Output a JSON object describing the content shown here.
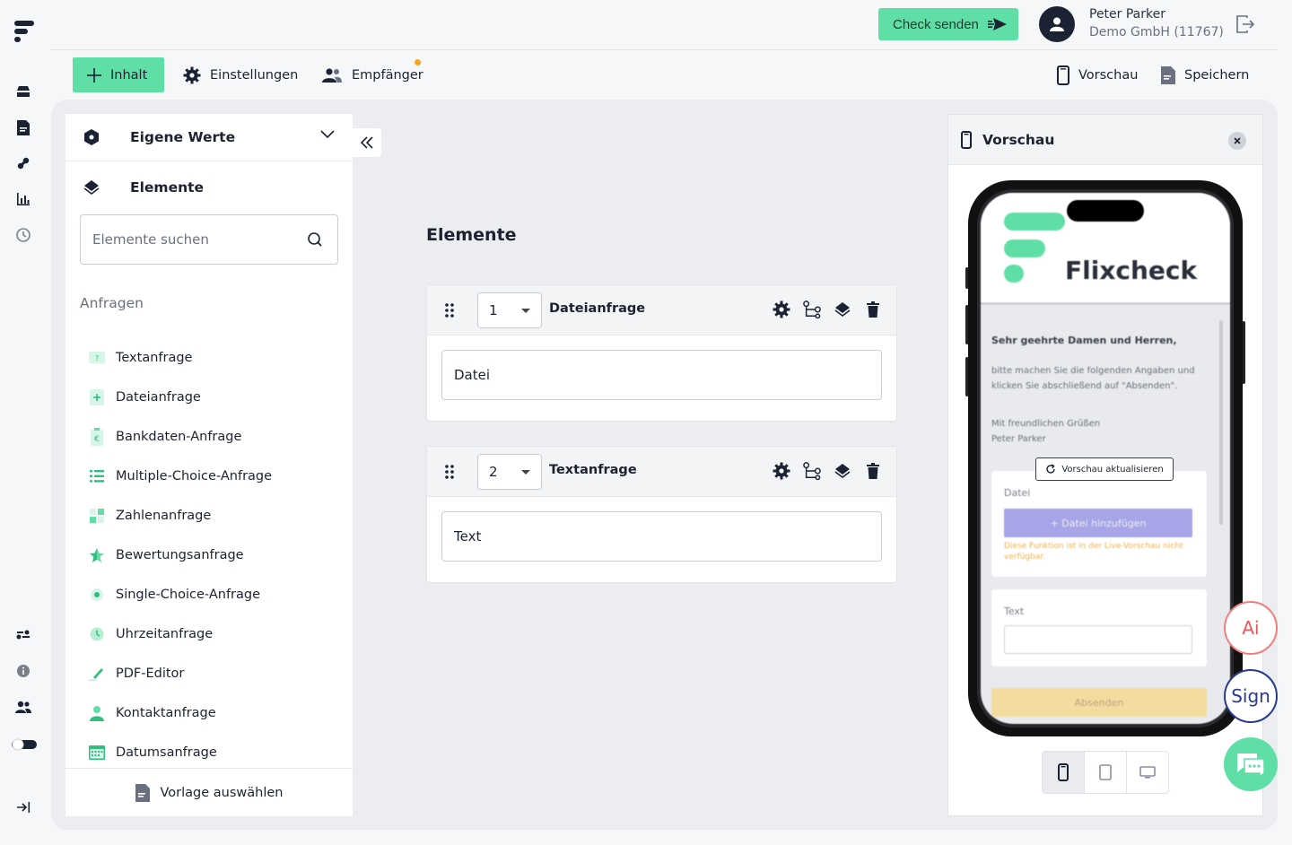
{
  "header": {
    "check_send_label": "Check senden",
    "user_name": "Peter Parker",
    "user_org": "Demo GmbH (11767)"
  },
  "toolbar": {
    "inhalt_label": "Inhalt",
    "einstellungen_label": "Einstellungen",
    "empfaenger_label": "Empfänger",
    "vorschau_label": "Vorschau",
    "speichern_label": "Speichern"
  },
  "sidebar": {
    "section_title": "Eigene Werte",
    "subsection_title": "Elemente",
    "search_placeholder": "Elemente suchen",
    "group_label": "Anfragen",
    "items": [
      {
        "label": "Textanfrage",
        "icon": "question-icon"
      },
      {
        "label": "Dateianfrage",
        "icon": "file-plus-icon"
      },
      {
        "label": "Bankdaten-Anfrage",
        "icon": "euro-icon"
      },
      {
        "label": "Multiple-Choice-Anfrage",
        "icon": "list-icon"
      },
      {
        "label": "Zahlenanfrage",
        "icon": "number-grid-icon"
      },
      {
        "label": "Bewertungsanfrage",
        "icon": "star-icon"
      },
      {
        "label": "Single-Choice-Anfrage",
        "icon": "radio-icon"
      },
      {
        "label": "Uhrzeitanfrage",
        "icon": "clock-icon"
      },
      {
        "label": "PDF-Editor",
        "icon": "pen-icon"
      },
      {
        "label": "Kontaktanfrage",
        "icon": "person-icon"
      },
      {
        "label": "Datumsanfrage",
        "icon": "calendar-icon"
      }
    ],
    "footer_label": "Vorlage auswählen"
  },
  "editor": {
    "title": "Elemente",
    "cards": [
      {
        "number": "1",
        "title": "Dateianfrage",
        "field_label": "Datei"
      },
      {
        "number": "2",
        "title": "Textanfrage",
        "field_label": "Text"
      }
    ]
  },
  "preview": {
    "title": "Vorschau",
    "phone": {
      "brand": "Flixcheck",
      "greeting": "Sehr geehrte Damen und Herren,",
      "body": "bitte machen Sie die folgenden Angaben und klicken Sie abschließend auf \"Absenden\".",
      "closing": "Mit freundlichen Grüßen",
      "signature": "Peter Parker",
      "refresh_label": "Vorschau aktualisieren",
      "file_label": "Datei",
      "file_button": "+ Datei hinzufügen",
      "file_warning": "Diese Funktion ist in der Live-Vorschau nicht verfügbar.",
      "text_label": "Text",
      "submit_label": "Absenden"
    }
  },
  "floating": {
    "ai_label": "Ai",
    "sign_label": "Sign"
  },
  "colors": {
    "accent": "#5fdfa6",
    "dark": "#1b2233",
    "notification": "#f5a524",
    "ai": "#e85a5a",
    "sign": "#2b3a8c"
  }
}
